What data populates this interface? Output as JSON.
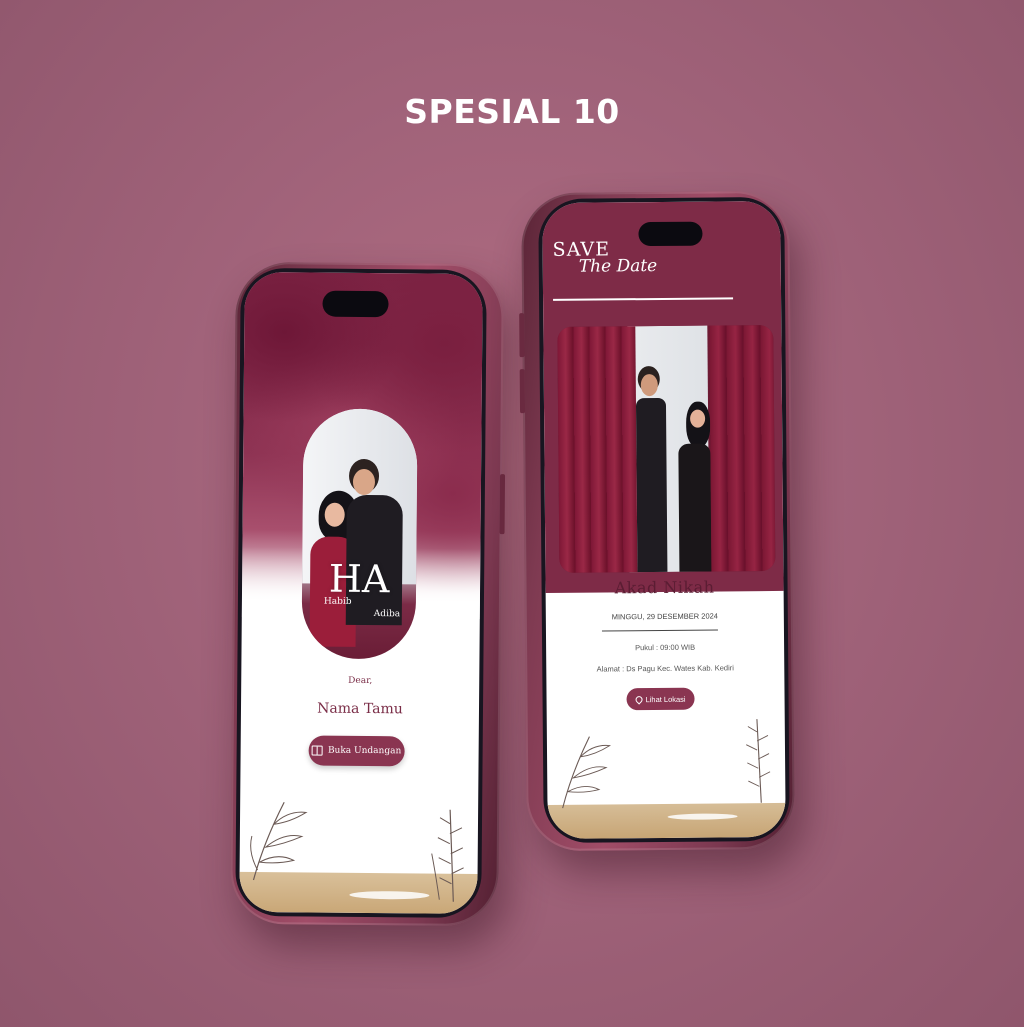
{
  "page": {
    "title": "SPESIAL 10",
    "background_color": "#a1637a",
    "accent_color": "#8a3551"
  },
  "left_phone": {
    "monogram": "HA",
    "groom_name": "Habib",
    "bride_name": "Adiba",
    "greeting": "Dear,",
    "guest_name": "Nama Tamu",
    "open_button": {
      "label": "Buka Undangan",
      "icon": "book-icon"
    }
  },
  "right_phone": {
    "save_text": "SAVE",
    "the_date_text": "The Date",
    "event_title": "Akad Nikah",
    "date": "MINGGU, 29 DESEMBER 2024",
    "time": "Pukul : 09:00 WIB",
    "address": "Alamat : Ds Pagu Kec. Wates Kab. Kediri",
    "location_button": {
      "label": "Lihat Lokasi",
      "icon": "location-pin-icon"
    }
  }
}
